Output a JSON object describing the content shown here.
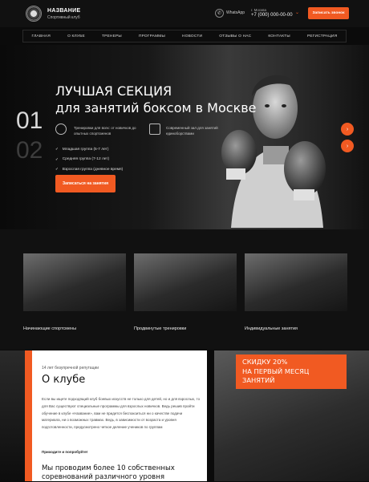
{
  "header": {
    "brand_name": "НАЗВАНИЕ",
    "brand_sub": "Спортивный клуб",
    "whatsapp": "WhatsApp",
    "city": "г. Москва",
    "phone": "+7 (000) 000-00-00",
    "callback_label": "Записать звонок"
  },
  "nav": [
    "ГЛАВНАЯ",
    "О КЛУБЕ",
    "ТРЕНЕРЫ",
    "ПРОГРАММЫ",
    "НОВОСТИ",
    "ОТЗЫВЫ О НАС",
    "КОНТАКТЫ",
    "РЕГИСТРАЦИЯ"
  ],
  "hero": {
    "title_line1": "ЛУЧШАЯ СЕКЦИЯ",
    "title_line2": "для занятий боксом в Москве",
    "slide_1": "01",
    "slide_2": "02",
    "feature_1": "Тренировки для всех: от новичков до опытных спортсменов",
    "feature_2": "Современный зал для занятий единоборствами",
    "groups": [
      "Младшая группа (5-7 лет)",
      "Средняя группа (7-12 лет)",
      "Взрослая группа (дневное время)"
    ],
    "enroll_label": "Записаться на занятия",
    "next_arrow": "›",
    "prev_arrow": "‹"
  },
  "cards": [
    {
      "label": "Начинающие спортсмены"
    },
    {
      "label": "Продвинутые тренировки"
    },
    {
      "label": "Индивидуальные занятия"
    }
  ],
  "about": {
    "kicker": "14 лет безупречной репутации",
    "title": "О клубе",
    "paragraph": "Если вы ищете подходящий клуб боевых искусств не только для детей, но и для взрослых, то для Вас существуют специальные программы для взрослых новичков. Ведь решив пройти обучение в клубе «Название», вам не придется беспокоиться ни о качестве подачи материала, ни о возможных травмах. Ведь, в зависимости от возраста и уровня подготовленности, предусмотрено четкое деление учеников по группам",
    "cta": "Приходите и попробуйте!",
    "heading_line1": "Мы проводим более 10 собственных",
    "heading_line2": "соревнований различного уровня"
  },
  "promo": {
    "line1": "СКИДКУ 20%",
    "line2": "НА ПЕРВЫЙ МЕСЯЦ ЗАНЯТИЙ"
  }
}
